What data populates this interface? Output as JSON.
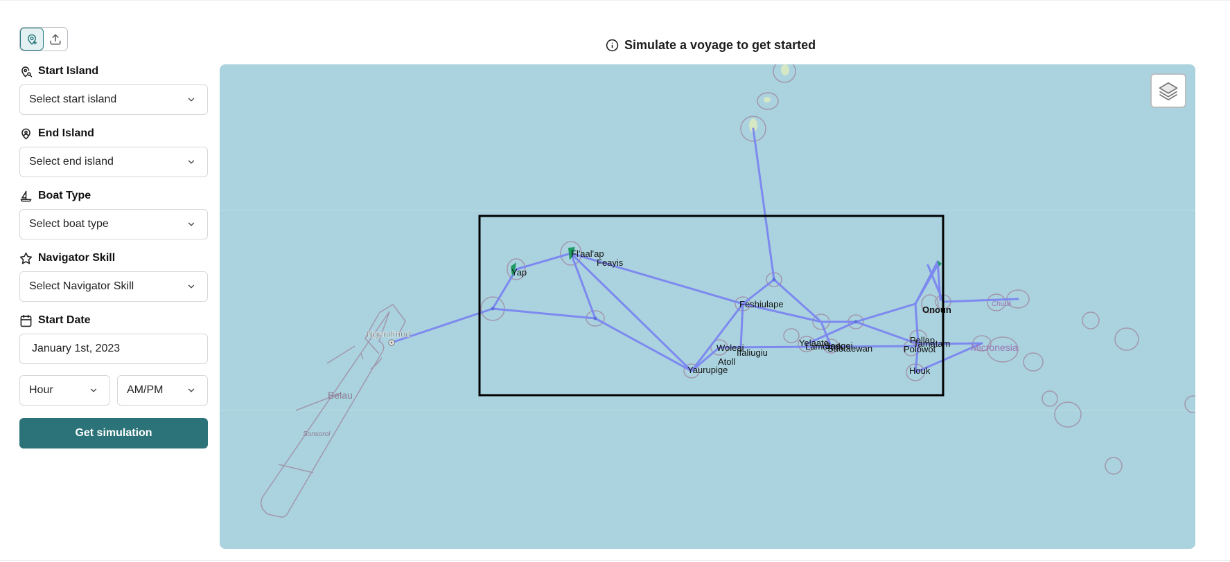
{
  "mode_toggle": {
    "items": [
      {
        "icon": "map-pin-plus-icon",
        "active": true
      },
      {
        "icon": "upload-icon",
        "active": false
      }
    ]
  },
  "form": {
    "start_island": {
      "label": "Start Island",
      "placeholder": "Select start island",
      "icon": "map-pin-search-icon"
    },
    "end_island": {
      "label": "End Island",
      "placeholder": "Select end island",
      "icon": "map-pin-user-icon"
    },
    "boat_type": {
      "label": "Boat Type",
      "placeholder": "Select boat type",
      "icon": "sailboat-icon"
    },
    "navigator_skill": {
      "label": "Navigator Skill",
      "placeholder": "Select Navigator Skill",
      "icon": "star-icon"
    },
    "start_date": {
      "label": "Start Date",
      "value": "January 1st, 2023",
      "icon": "calendar-icon"
    },
    "hour": {
      "placeholder": "Hour"
    },
    "ampm": {
      "placeholder": "AM/PM"
    },
    "submit_label": "Get simulation"
  },
  "banner": {
    "text": "Simulate a voyage to get started",
    "icon": "info-icon"
  },
  "map": {
    "island_labels": [
      {
        "id": "yap",
        "text": "Yap"
      },
      {
        "id": "fl",
        "text": "Fl'aal'ap"
      },
      {
        "id": "feayis",
        "text": "Feayis"
      },
      {
        "id": "feshiulape",
        "text": "Feshiulape"
      },
      {
        "id": "woleai",
        "text": "Woleai"
      },
      {
        "id": "atoll",
        "text": "Atoll"
      },
      {
        "id": "ifaliugiu",
        "text": "Ifaliugiu"
      },
      {
        "id": "yaurupige",
        "text": "Yaurupige"
      },
      {
        "id": "yelaato",
        "text": "Yelaato"
      },
      {
        "id": "lamo",
        "text": "Lamotrek"
      },
      {
        "id": "saegei",
        "text": "Saegei"
      },
      {
        "id": "saetaewan",
        "text": "Saetaewan"
      },
      {
        "id": "onoun",
        "text": "Onoun"
      },
      {
        "id": "pollap",
        "text": "Pollap"
      },
      {
        "id": "tamatam",
        "text": "Tamatam"
      },
      {
        "id": "polowot",
        "text": "Polowot"
      },
      {
        "id": "houk",
        "text": "Houk"
      }
    ],
    "basemap_labels": [
      {
        "id": "ngerulmud",
        "text": "Ngerulmud"
      },
      {
        "id": "belau",
        "text": "Belau"
      },
      {
        "id": "sonsorol",
        "text": "Sonsorol"
      },
      {
        "id": "micronesia",
        "text": "Micronesia"
      },
      {
        "id": "chuuk",
        "text": "Chuuk"
      }
    ],
    "layers_icon": "layers-icon",
    "colors": {
      "water": "#aad3df",
      "route": "#7b86f0",
      "island_outline": "#9b8fa8",
      "selection": "#000000",
      "vegetation": "#1f9a63"
    }
  }
}
